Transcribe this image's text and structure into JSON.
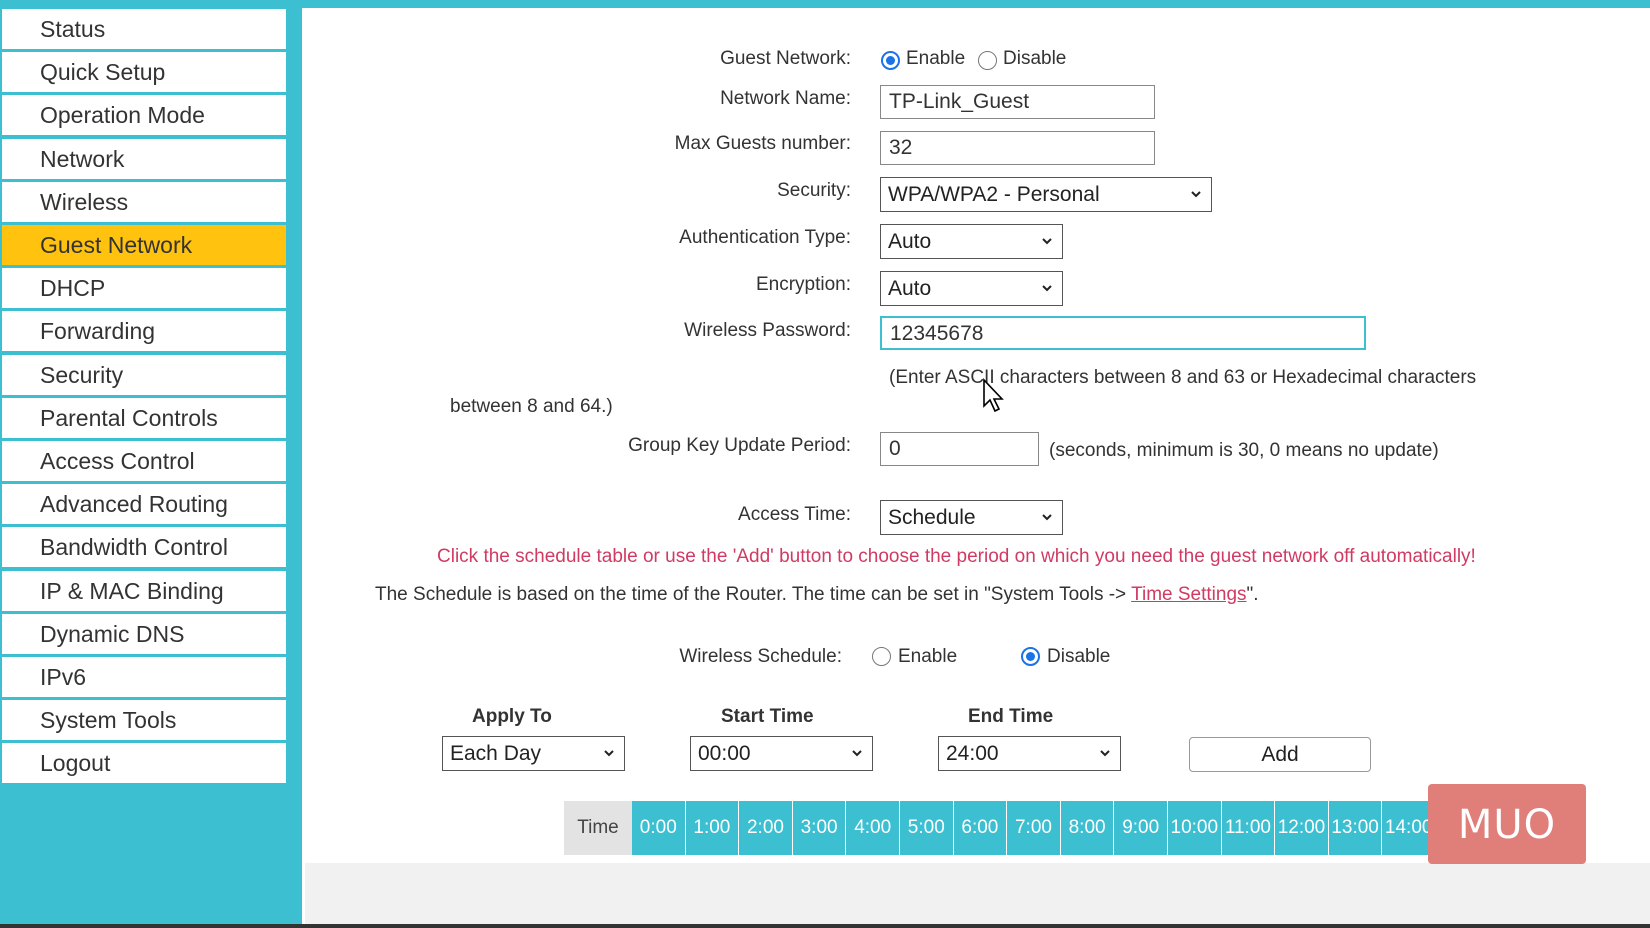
{
  "sidebar": {
    "items": [
      {
        "label": "Status"
      },
      {
        "label": "Quick Setup"
      },
      {
        "label": "Operation Mode"
      },
      {
        "label": "Network"
      },
      {
        "label": "Wireless"
      },
      {
        "label": "Guest Network",
        "active": true
      },
      {
        "label": "DHCP"
      },
      {
        "label": "Forwarding"
      },
      {
        "label": "Security"
      },
      {
        "label": "Parental Controls"
      },
      {
        "label": "Access Control"
      },
      {
        "label": "Advanced Routing"
      },
      {
        "label": "Bandwidth Control"
      },
      {
        "label": "IP & MAC Binding"
      },
      {
        "label": "Dynamic DNS"
      },
      {
        "label": "IPv6"
      },
      {
        "label": "System Tools"
      },
      {
        "label": "Logout"
      }
    ]
  },
  "form": {
    "guest_network": {
      "label": "Guest Network:",
      "enable": "Enable",
      "disable": "Disable",
      "selected": "Enable"
    },
    "network_name": {
      "label": "Network Name:",
      "value": "TP-Link_Guest"
    },
    "max_guests": {
      "label": "Max Guests number:",
      "value": "32"
    },
    "security": {
      "label": "Security:",
      "value": "WPA/WPA2 - Personal"
    },
    "auth_type": {
      "label": "Authentication Type:",
      "value": "Auto"
    },
    "encryption": {
      "label": "Encryption:",
      "value": "Auto"
    },
    "password": {
      "label": "Wireless Password:",
      "value": "12345678",
      "hint1": "(Enter ASCII characters between 8 and 63 or Hexadecimal characters",
      "hint2": "between 8 and 64.)"
    },
    "group_key": {
      "label": "Group Key Update Period:",
      "value": "0",
      "hint": "(seconds, minimum is 30, 0 means no update)"
    },
    "access_time": {
      "label": "Access Time:",
      "value": "Schedule"
    },
    "schedule_notice": "Click the schedule table or use the 'Add' button to choose the period on which you need the guest network off automatically!",
    "schedule_info_prefix": "The Schedule is based on the time of the Router. The time can be set in \"System Tools -> ",
    "schedule_info_link": "Time Settings",
    "schedule_info_suffix": "\".",
    "wireless_schedule": {
      "label": "Wireless Schedule:",
      "enable": "Enable",
      "disable": "Disable",
      "selected": "Disable"
    },
    "apply_to": {
      "label": "Apply To",
      "value": "Each Day"
    },
    "start_time": {
      "label": "Start Time",
      "value": "00:00"
    },
    "end_time": {
      "label": "End Time",
      "value": "24:00"
    },
    "add_button": "Add"
  },
  "schedule_table": {
    "head": "Time",
    "hours": [
      "0:00",
      "1:00",
      "2:00",
      "3:00",
      "4:00",
      "5:00",
      "6:00",
      "7:00",
      "8:00",
      "9:00",
      "10:00",
      "11:00",
      "12:00",
      "13:00",
      "14:00"
    ]
  },
  "watermark": "MUO",
  "colors": {
    "accent": "#3bbfd1",
    "active": "#ffc20e",
    "notice": "#d03a63",
    "radio": "#1a73e8"
  }
}
